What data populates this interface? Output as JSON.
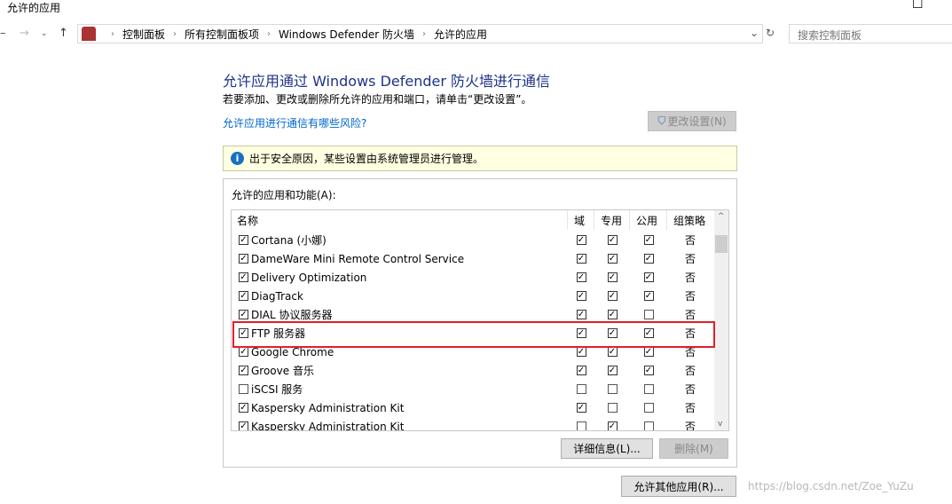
{
  "window": {
    "title": "允许的应用",
    "maximize_icon": "☐"
  },
  "address": {
    "crumbs": [
      "控制面板",
      "所有控制面板项",
      "Windows Defender 防火墙",
      "允许的应用"
    ],
    "search_placeholder": "搜索控制面板"
  },
  "main": {
    "heading": "允许应用通过 Windows Defender 防火墙进行通信",
    "subtitle": "若要添加、更改或删除所允许的应用和端口，请单击“更改设置”。",
    "risk_link": "允许应用进行通信有哪些风险?",
    "change_settings": "更改设置(N)",
    "info": "出于安全原因，某些设置由系统管理员进行管理。",
    "list_label": "允许的应用和功能(A):",
    "columns": {
      "name": "名称",
      "domain": "域",
      "private": "专用",
      "public": "公用",
      "policy": "组策略"
    },
    "rows": [
      {
        "name": "Cortana (小娜)",
        "enabled": true,
        "domain": true,
        "private": true,
        "public": true,
        "policy": "否"
      },
      {
        "name": "DameWare Mini Remote Control Service",
        "enabled": true,
        "domain": true,
        "private": true,
        "public": true,
        "policy": "否"
      },
      {
        "name": "Delivery Optimization",
        "enabled": true,
        "domain": true,
        "private": true,
        "public": true,
        "policy": "否"
      },
      {
        "name": "DiagTrack",
        "enabled": true,
        "domain": true,
        "private": true,
        "public": true,
        "policy": "否"
      },
      {
        "name": "DIAL 协议服务器",
        "enabled": true,
        "domain": true,
        "private": true,
        "public": false,
        "policy": "否"
      },
      {
        "name": "FTP 服务器",
        "enabled": true,
        "domain": true,
        "private": true,
        "public": true,
        "policy": "否"
      },
      {
        "name": "Google Chrome",
        "enabled": true,
        "domain": true,
        "private": true,
        "public": true,
        "policy": "否"
      },
      {
        "name": "Groove 音乐",
        "enabled": true,
        "domain": true,
        "private": true,
        "public": true,
        "policy": "否"
      },
      {
        "name": "iSCSI 服务",
        "enabled": false,
        "domain": false,
        "private": false,
        "public": false,
        "policy": "否"
      },
      {
        "name": "Kaspersky Administration Kit",
        "enabled": true,
        "domain": true,
        "private": false,
        "public": false,
        "policy": "否"
      },
      {
        "name": "Kaspersky Administration Kit",
        "enabled": true,
        "domain": false,
        "private": true,
        "public": false,
        "policy": "否"
      }
    ],
    "details_button": "详细信息(L)...",
    "remove_button": "删除(M)",
    "allow_other_button": "允许其他应用(R)..."
  },
  "watermark": "https://blog.csdn.net/Zoe_YuZu"
}
